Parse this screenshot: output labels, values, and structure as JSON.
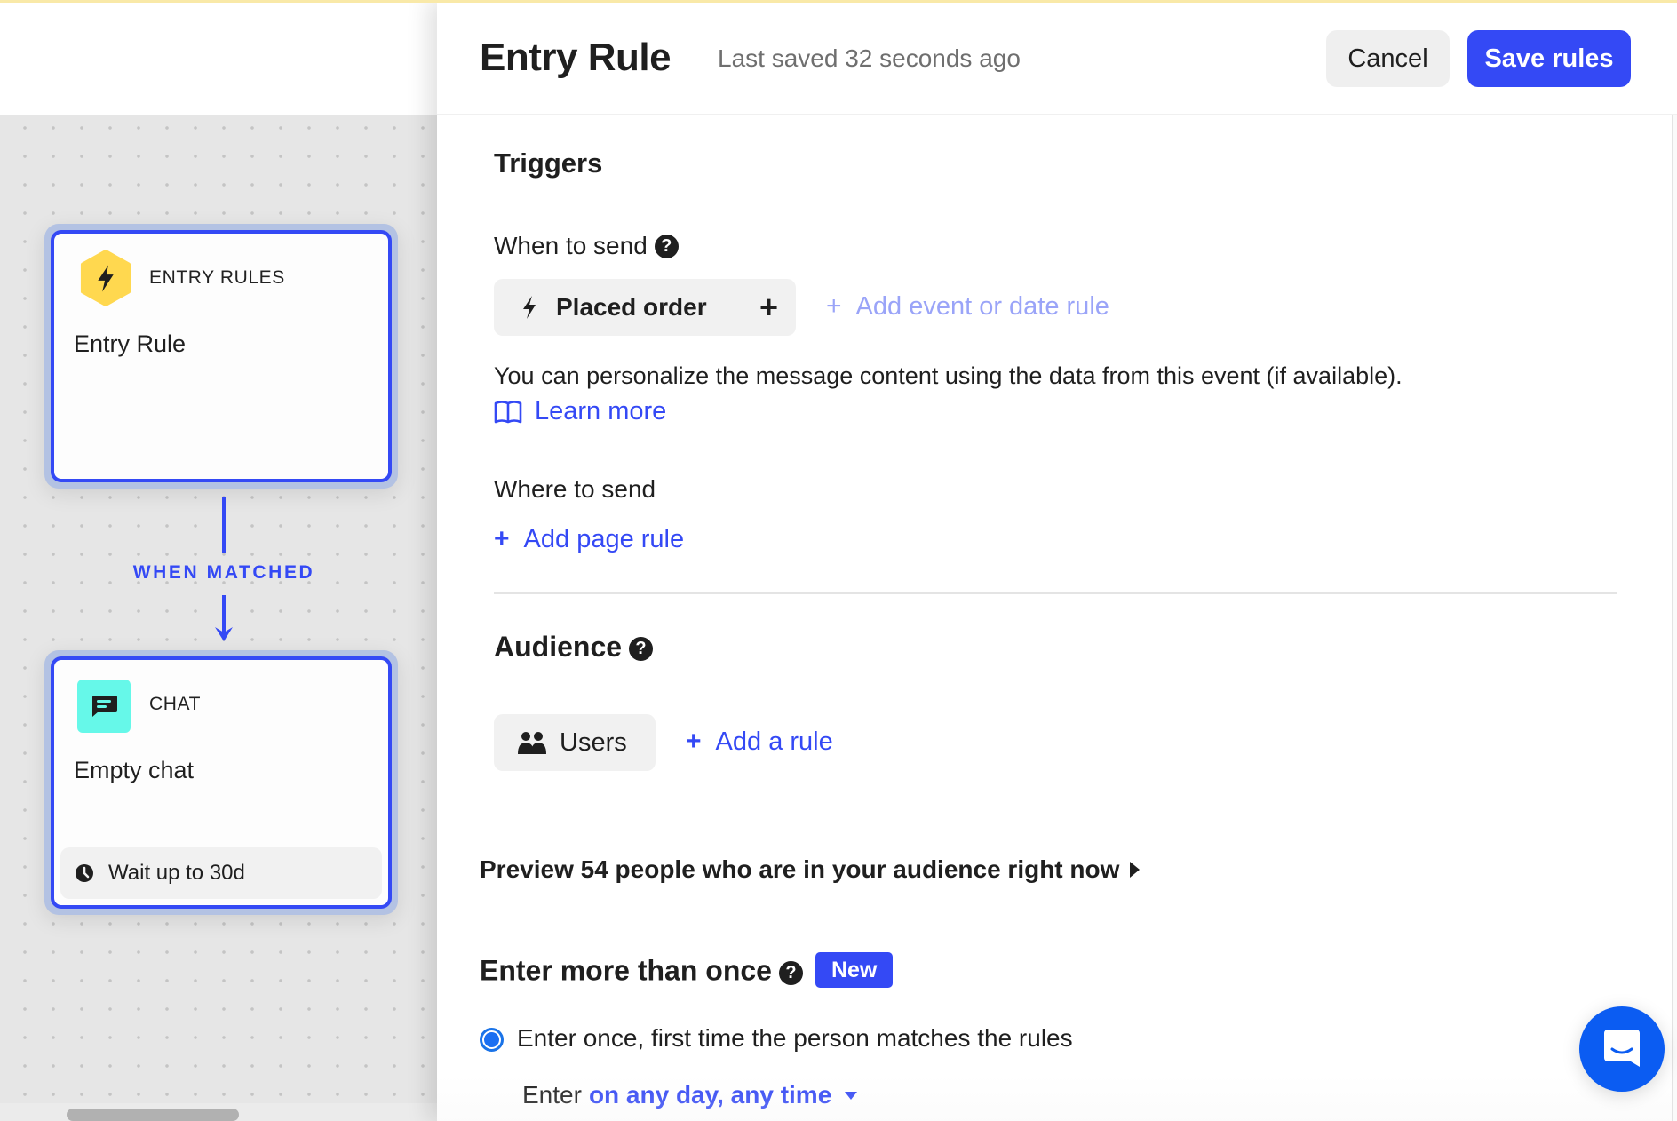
{
  "canvas": {
    "entry_node": {
      "type_label": "ENTRY RULES",
      "title": "Entry Rule",
      "icon": "lightning-icon",
      "icon_color": "#ffd84f"
    },
    "connector_label": "WHEN MATCHED",
    "chat_node": {
      "type_label": "CHAT",
      "title": "Empty chat",
      "icon": "chat-bubble-icon",
      "icon_color": "#66f8e9",
      "footer": "Wait up to 30d",
      "footer_icon": "clock-icon"
    },
    "accent_color": "#3449f5"
  },
  "panel": {
    "title": "Entry Rule",
    "last_saved": "Last saved 32 seconds ago",
    "cancel_label": "Cancel",
    "save_label": "Save rules",
    "triggers": {
      "heading": "Triggers",
      "when_to_send": {
        "label": "When to send",
        "event_chip": "Placed order",
        "add_event_link": "Add event or date rule",
        "description": "You can personalize the message content using the data from this event (if available).",
        "learn_more": "Learn more"
      },
      "where_to_send": {
        "label": "Where to send",
        "add_page_rule": "Add page rule"
      }
    },
    "audience": {
      "heading": "Audience",
      "users_chip": "Users",
      "add_rule": "Add a rule",
      "preview": "Preview 54 people who are in your audience right now"
    },
    "enter_more": {
      "heading": "Enter more than once",
      "badge": "New",
      "option_selected": "Enter once, first time the person matches the rules",
      "enter_prefix": "Enter",
      "enter_schedule": "on any day, any time"
    }
  }
}
